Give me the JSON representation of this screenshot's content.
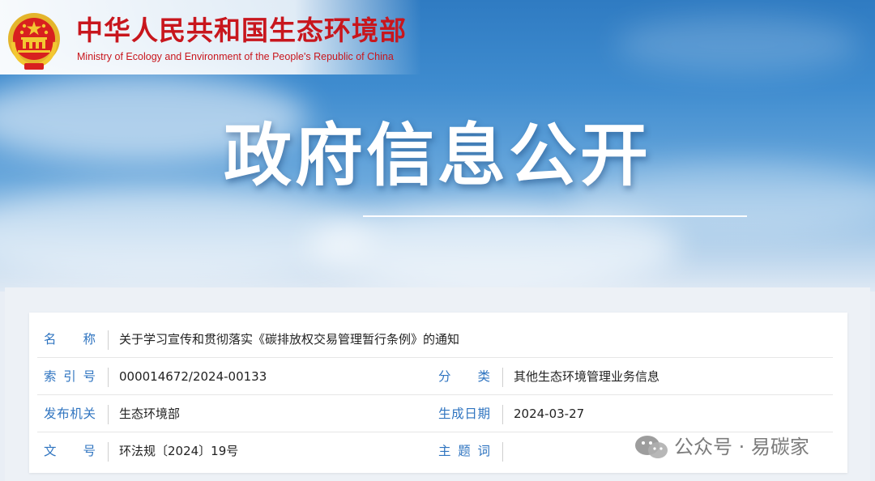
{
  "header": {
    "title_cn": "中华人民共和国生态环境部",
    "title_en": "Ministry of Ecology and Environment of the People's Republic of China"
  },
  "banner": {
    "heading": "政府信息公开"
  },
  "info_table": {
    "name_label": "名　　称",
    "name_value": "关于学习宣传和贯彻落实《碳排放权交易管理暂行条例》的通知",
    "index_label": "索 引 号",
    "index_value": "000014672/2024-00133",
    "category_label": "分　　类",
    "category_value": "其他生态环境管理业务信息",
    "issuer_label": "发布机关",
    "issuer_value": "生态环境部",
    "date_label": "生成日期",
    "date_value": "2024-03-27",
    "doc_no_label": "文　　号",
    "doc_no_value": "环法规〔2024〕19号",
    "keywords_label": "主 题 词",
    "keywords_value": ""
  },
  "watermark": {
    "text": "公众号 · 易碳家",
    "icon": "wechat-icon"
  },
  "colors": {
    "brand_red": "#c8161d",
    "label_blue": "#2f74c0"
  }
}
